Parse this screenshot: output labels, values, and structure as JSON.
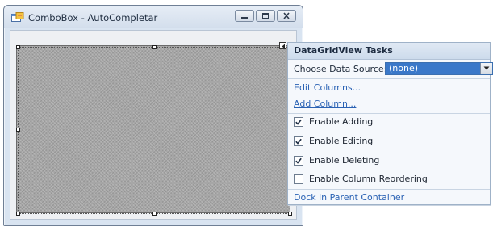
{
  "window": {
    "title": "ComboBox - AutoCompletar",
    "icon": "form-app-icon"
  },
  "tasks": {
    "title": "DataGridView Tasks",
    "data_source_label": "Choose Data Source:",
    "data_source_value": "(none)",
    "edit_columns": "Edit Columns...",
    "add_column": "Add Column...",
    "checkboxes": [
      {
        "label": "Enable Adding",
        "checked": true
      },
      {
        "label": "Enable Editing",
        "checked": true
      },
      {
        "label": "Enable Deleting",
        "checked": true
      },
      {
        "label": "Enable Column Reordering",
        "checked": false
      }
    ],
    "dock": "Dock in Parent Container"
  },
  "colors": {
    "link": "#2a62b4",
    "combo_selected": "#3a78c9",
    "grid": "#a6a6a6"
  }
}
